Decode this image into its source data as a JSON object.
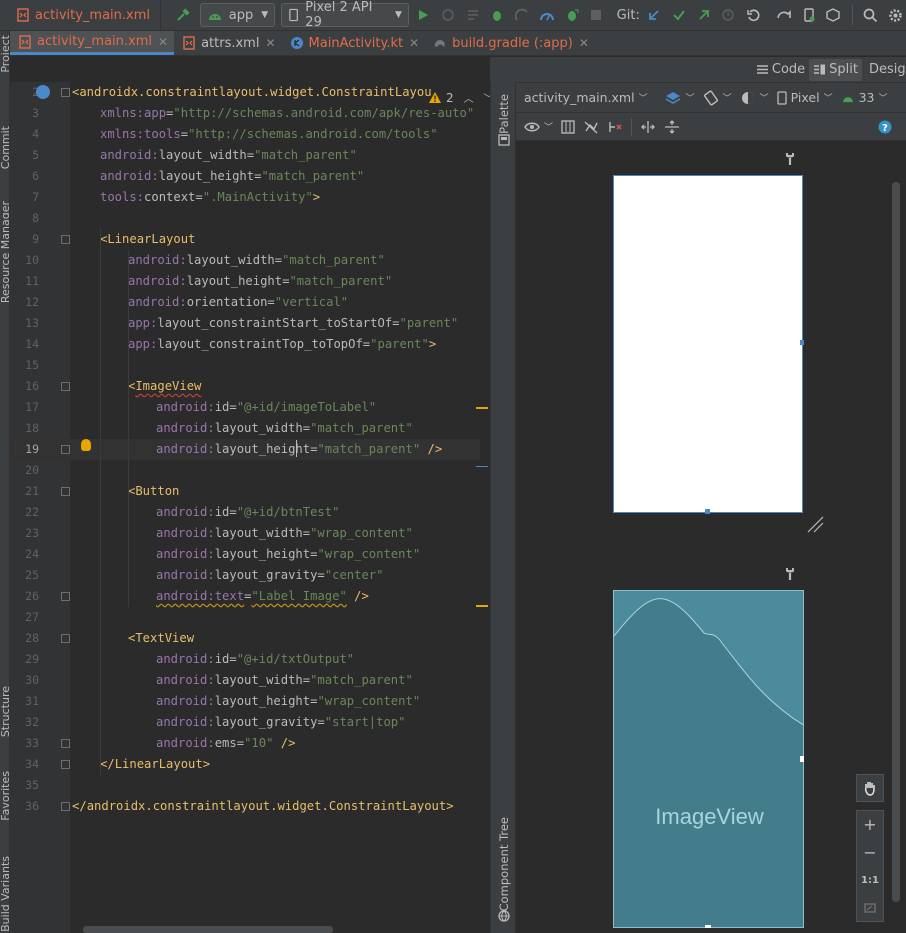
{
  "toolbar": {
    "file": "activity_main.xml",
    "module": "app",
    "device": "Pixel 2 API 29",
    "git_label": "Git:"
  },
  "tabs": [
    {
      "label": "activity_main.xml",
      "active": true,
      "color": "red"
    },
    {
      "label": "attrs.xml",
      "active": false,
      "color": "normal"
    },
    {
      "label": "MainActivity.kt",
      "active": false,
      "color": "red"
    },
    {
      "label": "build.gradle (:app)",
      "active": false,
      "color": "red"
    }
  ],
  "left_strip": {
    "project": "Project",
    "commit": "Commit",
    "resource_manager": "Resource Manager",
    "structure": "Structure",
    "favorites": "Favorites",
    "build_variants": "Build Variants"
  },
  "view_modes": {
    "code": "Code",
    "split": "Split",
    "design": "Design"
  },
  "editor": {
    "warnings": "2",
    "current_line": "19",
    "lines": [
      {
        "n": "2",
        "indent": 0,
        "parts": [
          [
            "punct",
            "<"
          ],
          [
            "tag",
            "androidx.constraintlayout.widget.ConstraintLayou"
          ]
        ]
      },
      {
        "n": "3",
        "indent": 1,
        "parts": [
          [
            "ns",
            "xmlns:app"
          ],
          [
            "attr",
            "="
          ],
          [
            "val",
            "\"http://schemas.android.com/apk/res-auto\""
          ]
        ]
      },
      {
        "n": "4",
        "indent": 1,
        "parts": [
          [
            "ns",
            "xmlns:tools"
          ],
          [
            "attr",
            "="
          ],
          [
            "val",
            "\"http://schemas.android.com/tools\""
          ]
        ]
      },
      {
        "n": "5",
        "indent": 1,
        "parts": [
          [
            "ns",
            "android:"
          ],
          [
            "attr",
            "layout_width="
          ],
          [
            "val",
            "\"match_parent\""
          ]
        ]
      },
      {
        "n": "6",
        "indent": 1,
        "parts": [
          [
            "ns",
            "android:"
          ],
          [
            "attr",
            "layout_height="
          ],
          [
            "val",
            "\"match_parent\""
          ]
        ]
      },
      {
        "n": "7",
        "indent": 1,
        "parts": [
          [
            "ns",
            "tools:"
          ],
          [
            "attr",
            "context="
          ],
          [
            "val",
            "\".MainActivity\""
          ],
          [
            "punct",
            ">"
          ]
        ]
      },
      {
        "n": "8",
        "indent": 0,
        "parts": []
      },
      {
        "n": "9",
        "indent": 1,
        "parts": [
          [
            "punct",
            "<"
          ],
          [
            "tag",
            "LinearLayout"
          ]
        ]
      },
      {
        "n": "10",
        "indent": 2,
        "parts": [
          [
            "ns",
            "android:"
          ],
          [
            "attr",
            "layout_width="
          ],
          [
            "val",
            "\"match_parent\""
          ]
        ]
      },
      {
        "n": "11",
        "indent": 2,
        "parts": [
          [
            "ns",
            "android:"
          ],
          [
            "attr",
            "layout_height="
          ],
          [
            "val",
            "\"match_parent\""
          ]
        ]
      },
      {
        "n": "12",
        "indent": 2,
        "parts": [
          [
            "ns",
            "android:"
          ],
          [
            "attr",
            "orientation="
          ],
          [
            "val",
            "\"vertical\""
          ]
        ]
      },
      {
        "n": "13",
        "indent": 2,
        "parts": [
          [
            "ns",
            "app:"
          ],
          [
            "attr",
            "layout_constraintStart_toStartOf="
          ],
          [
            "val",
            "\"parent\""
          ]
        ]
      },
      {
        "n": "14",
        "indent": 2,
        "parts": [
          [
            "ns",
            "app:"
          ],
          [
            "attr",
            "layout_constraintTop_toTopOf="
          ],
          [
            "val",
            "\"parent\""
          ],
          [
            "punct",
            ">"
          ]
        ]
      },
      {
        "n": "15",
        "indent": 0,
        "parts": []
      },
      {
        "n": "16",
        "indent": 2,
        "parts": [
          [
            "punct",
            "<"
          ],
          [
            "tagsq",
            "ImageView"
          ]
        ]
      },
      {
        "n": "17",
        "indent": 3,
        "parts": [
          [
            "ns",
            "android:"
          ],
          [
            "attr",
            "id="
          ],
          [
            "val",
            "\"@+id/imageToLabel\""
          ]
        ]
      },
      {
        "n": "18",
        "indent": 3,
        "parts": [
          [
            "ns",
            "android:"
          ],
          [
            "attr",
            "layout_width="
          ],
          [
            "val",
            "\"match_parent\""
          ]
        ]
      },
      {
        "n": "19",
        "indent": 3,
        "parts": [
          [
            "ns",
            "android:"
          ],
          [
            "attr",
            "layout_height="
          ],
          [
            "val",
            "\"match_parent\""
          ],
          [
            "punct",
            " />"
          ]
        ]
      },
      {
        "n": "20",
        "indent": 0,
        "parts": []
      },
      {
        "n": "21",
        "indent": 2,
        "parts": [
          [
            "punct",
            "<"
          ],
          [
            "tag",
            "Button"
          ]
        ]
      },
      {
        "n": "22",
        "indent": 3,
        "parts": [
          [
            "ns",
            "android:"
          ],
          [
            "attr",
            "id="
          ],
          [
            "val",
            "\"@+id/btnTest\""
          ]
        ]
      },
      {
        "n": "23",
        "indent": 3,
        "parts": [
          [
            "ns",
            "android:"
          ],
          [
            "attr",
            "layout_width="
          ],
          [
            "val",
            "\"wrap_content\""
          ]
        ]
      },
      {
        "n": "24",
        "indent": 3,
        "parts": [
          [
            "ns",
            "android:"
          ],
          [
            "attr",
            "layout_height="
          ],
          [
            "val",
            "\"wrap_content\""
          ]
        ]
      },
      {
        "n": "25",
        "indent": 3,
        "parts": [
          [
            "ns",
            "android:"
          ],
          [
            "attr",
            "layout_gravity="
          ],
          [
            "val",
            "\"center\""
          ]
        ]
      },
      {
        "n": "26",
        "indent": 3,
        "parts": [
          [
            "nssq",
            "android:text"
          ],
          [
            "attr",
            "="
          ],
          [
            "valsq",
            "\"Label Image\""
          ],
          [
            "punct",
            " />"
          ]
        ]
      },
      {
        "n": "27",
        "indent": 0,
        "parts": []
      },
      {
        "n": "28",
        "indent": 2,
        "parts": [
          [
            "punct",
            "<"
          ],
          [
            "tag",
            "TextView"
          ]
        ]
      },
      {
        "n": "29",
        "indent": 3,
        "parts": [
          [
            "ns",
            "android:"
          ],
          [
            "attr",
            "id="
          ],
          [
            "val",
            "\"@+id/txtOutput\""
          ]
        ]
      },
      {
        "n": "30",
        "indent": 3,
        "parts": [
          [
            "ns",
            "android:"
          ],
          [
            "attr",
            "layout_width="
          ],
          [
            "val",
            "\"match_parent\""
          ]
        ]
      },
      {
        "n": "31",
        "indent": 3,
        "parts": [
          [
            "ns",
            "android:"
          ],
          [
            "attr",
            "layout_height="
          ],
          [
            "val",
            "\"wrap_content\""
          ]
        ]
      },
      {
        "n": "32",
        "indent": 3,
        "parts": [
          [
            "ns",
            "android:"
          ],
          [
            "attr",
            "layout_gravity="
          ],
          [
            "val",
            "\"start|top\""
          ]
        ]
      },
      {
        "n": "33",
        "indent": 3,
        "parts": [
          [
            "ns",
            "android:"
          ],
          [
            "attr",
            "ems="
          ],
          [
            "val",
            "\"10\""
          ],
          [
            "punct",
            " />"
          ]
        ]
      },
      {
        "n": "34",
        "indent": 1,
        "parts": [
          [
            "punct",
            "</"
          ],
          [
            "tag",
            "LinearLayout"
          ],
          [
            "punct",
            ">"
          ]
        ]
      },
      {
        "n": "35",
        "indent": 0,
        "parts": []
      },
      {
        "n": "36",
        "indent": 0,
        "parts": [
          [
            "punct",
            "</"
          ],
          [
            "tag",
            "androidx.constraintlayout.widget.ConstraintLayout"
          ],
          [
            "punct",
            ">"
          ]
        ]
      }
    ]
  },
  "side_panels": {
    "palette": "Palette",
    "component_tree": "Component Tree"
  },
  "design_toolbar": {
    "file": "activity_main.xml",
    "device": "Pixel",
    "api": "33"
  },
  "preview": {
    "imageview_label": "ImageView"
  },
  "zoom": {
    "in": "+",
    "out": "−",
    "one_to_one": "1:1"
  },
  "colors": {
    "accent": "#4a88c7",
    "red_file": "#e06c4a",
    "run_green": "#499c54",
    "warning": "#e6a700"
  }
}
